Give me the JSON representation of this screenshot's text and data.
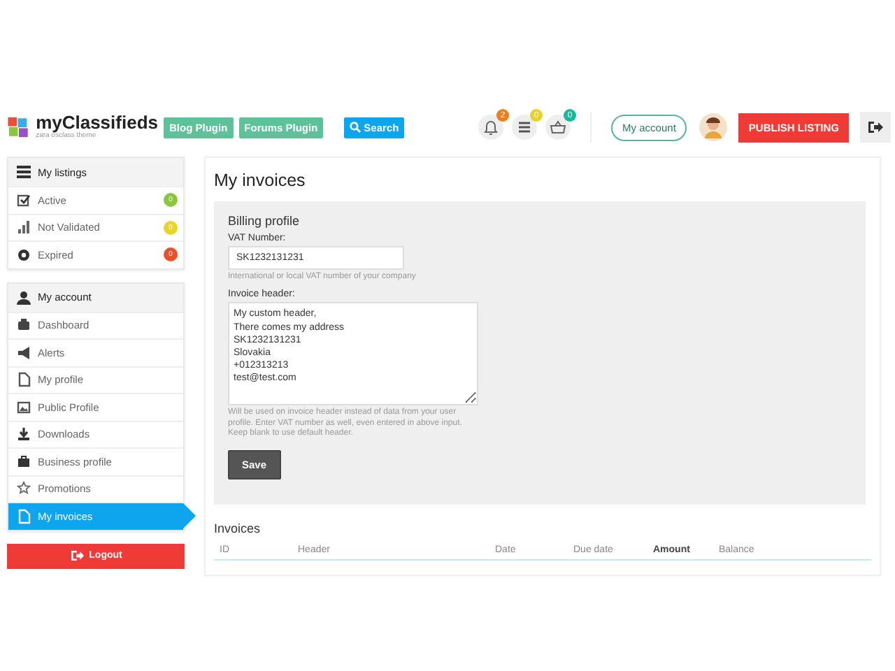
{
  "header": {
    "logo_title": "myClassifieds",
    "logo_subtitle": "zara osclass theme",
    "links": [
      {
        "label": "Blog Plugin",
        "kind": "plugin"
      },
      {
        "label": "Forums Plugin",
        "kind": "plugin"
      },
      {
        "label": "Search",
        "kind": "search"
      }
    ],
    "notifications": [
      {
        "count": "2",
        "color": "#f07d1a"
      },
      {
        "count": "0",
        "color": "#e6d22a"
      },
      {
        "count": "0",
        "color": "#19b89a"
      }
    ],
    "account_button": "My account",
    "publish_button": "PUBLISH LISTING"
  },
  "sidebar": {
    "listings": {
      "title": "My listings",
      "items": [
        {
          "label": "Active",
          "count": "0",
          "color": "#8cc63f"
        },
        {
          "label": "Not Validated",
          "count": "0",
          "color": "#e8d42a"
        },
        {
          "label": "Expired",
          "count": "0",
          "color": "#e8522a"
        }
      ]
    },
    "account": {
      "title": "My account",
      "items": [
        {
          "label": "Dashboard",
          "selected": false
        },
        {
          "label": "Alerts",
          "selected": false
        },
        {
          "label": "My profile",
          "selected": false
        },
        {
          "label": "Public Profile",
          "selected": false
        },
        {
          "label": "Downloads",
          "selected": false
        },
        {
          "label": "Business profile",
          "selected": false
        },
        {
          "label": "Promotions",
          "selected": false
        },
        {
          "label": "My invoices",
          "selected": true
        }
      ]
    },
    "logout": "Logout"
  },
  "main": {
    "title": "My invoices",
    "billing": {
      "title": "Billing profile",
      "vat_label": "VAT Number:",
      "vat_value": "SK1232131231",
      "vat_help": "International or local VAT number of your company",
      "header_label": "Invoice header:",
      "header_value": "My custom header,\nThere comes my address\nSK1232131231\nSlovakia\n+012313213\ntest@test.com",
      "header_help": "Will be used on invoice header instead of data from your user profile. Enter VAT number as well, even entered in above input. Keep blank to use default header.",
      "save": "Save"
    },
    "invoices": {
      "title": "Invoices",
      "columns": [
        {
          "label": "ID",
          "bold": false
        },
        {
          "label": "Header",
          "bold": false
        },
        {
          "label": "Date",
          "bold": false
        },
        {
          "label": "Due date",
          "bold": false
        },
        {
          "label": "Amount",
          "bold": true
        },
        {
          "label": "Balance",
          "bold": false
        }
      ]
    }
  }
}
